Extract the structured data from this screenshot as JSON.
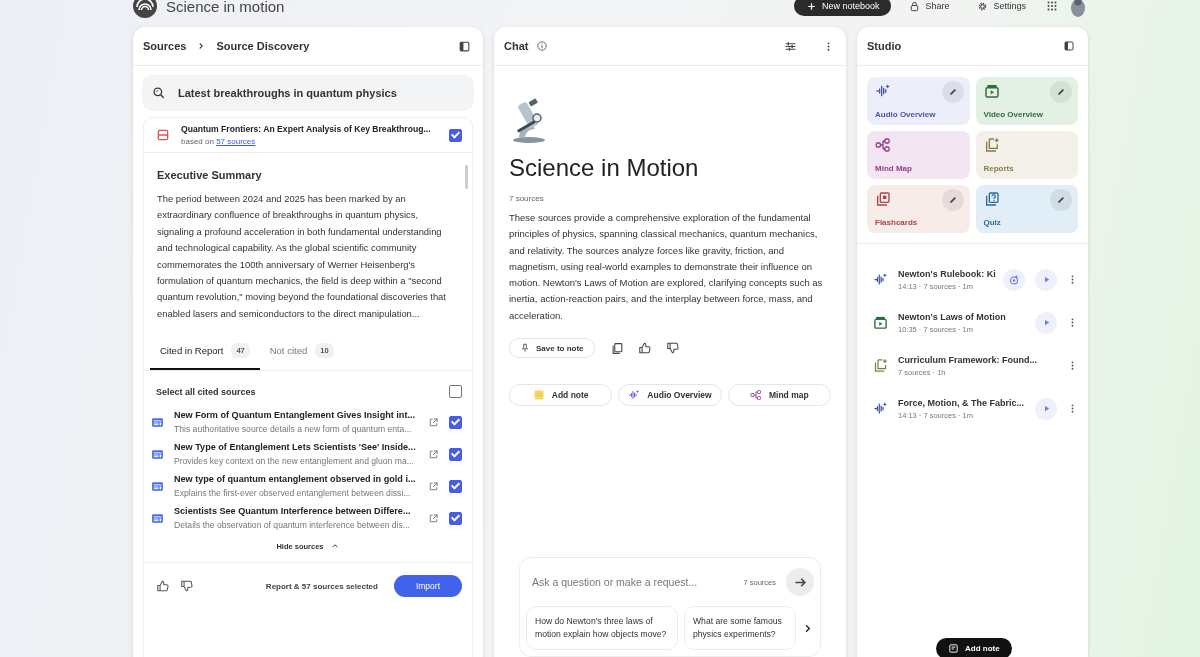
{
  "app": {
    "title": "Science in motion",
    "actions": [
      {
        "label": "New notebook",
        "kind": "primary"
      },
      {
        "label": "Share",
        "kind": "share"
      },
      {
        "label": "Settings",
        "kind": "settings"
      }
    ]
  },
  "sources": {
    "breadcrumb": [
      "Sources",
      "Source Discovery"
    ],
    "query": "Latest breakthroughs in quantum physics",
    "report": {
      "title": "Quantum Frontiers: An Expert Analysis of Key Breakthroug...",
      "based_on": "based on",
      "link": "57 sources",
      "checked": true,
      "heading": "Executive Summary",
      "body": "The period between 2024 and 2025 has been marked by an extraordinary confluence of breakthroughs in quantum physics, signaling a profound acceleration in both fundamental understanding and technological capability. As the global scientific community commemorates the 100th anniversary of Werner Heisenberg's formulation of quantum mechanics, the field is deep within a \"second quantum revolution,\" moving beyond the foundational discoveries that enabled lasers and semiconductors to the direct manipulation..."
    },
    "tabs": [
      {
        "label": "Cited in Report",
        "count": "47",
        "selected": true
      },
      {
        "label": "Not cited",
        "count": "10",
        "selected": false
      }
    ],
    "select_all": {
      "label": "Select all cited sources",
      "checked": false
    },
    "items": [
      {
        "title": "New Form of Quantum Entanglement Gives Insight int...",
        "description": "This authoritative source details a new form of quantum enta...",
        "checked": true
      },
      {
        "title": "New Type of Entanglement Lets Scientists 'See' Inside...",
        "description": "Provides key context on the new entanglement and gluon ma...",
        "checked": true
      },
      {
        "title": "New type of quantum entanglement observed in gold i...",
        "description": "Explains the first-ever observed entanglement between dissi...",
        "checked": true
      },
      {
        "title": "Scientists See Quantum Interference between Differe...",
        "description": "Details the observation of quantum interference between dis...",
        "checked": true
      }
    ],
    "hide_label": "Hide sources",
    "footer": {
      "status": "Report & 57 sources selected",
      "button": "Import"
    }
  },
  "chat": {
    "title": "Chat",
    "notebook_title": "Science in Motion",
    "source_count": "7 sources",
    "summary": "These sources provide a comprehensive exploration of the fundamental principles of physics, spanning classical mechanics, quantum mechanics, and relativity. The sources analyze forces like gravity, friction, and magnetism, using real-world examples to demonstrate their influence on motion. Newton's Laws of Motion are explored, clarifying concepts such as inertia, action-reaction pairs, and the interplay between force, mass, and acceleration.",
    "save_label": "Save to note",
    "chips": [
      {
        "label": "Add note",
        "kind": "note"
      },
      {
        "label": "Audio Overview",
        "kind": "audio"
      },
      {
        "label": "Mind map",
        "kind": "mindmap"
      }
    ],
    "input": {
      "placeholder": "Ask a question or make a request...",
      "source_count": "7 sources"
    },
    "suggestions": [
      "How do Newton's three laws of motion explain how objects move?",
      "What are some famous physics experiments?"
    ]
  },
  "studio": {
    "title": "Studio",
    "tiles": [
      {
        "label": "Audio Overview",
        "kind": "audio",
        "editable": true,
        "color": "#eceefa"
      },
      {
        "label": "Video Overview",
        "kind": "video",
        "editable": true,
        "color": "#e3f1e4"
      },
      {
        "label": "Mind Map",
        "kind": "mindmap",
        "editable": false,
        "color": "#f3e6f2"
      },
      {
        "label": "Reports",
        "kind": "reports",
        "editable": false,
        "color": "#f2f0e8"
      },
      {
        "label": "Flashcards",
        "kind": "flashcards",
        "editable": true,
        "color": "#f8ece9"
      },
      {
        "label": "Quiz",
        "kind": "quiz",
        "editable": true,
        "color": "#e1eef7"
      }
    ],
    "outputs": [
      {
        "title": "Newton's Rulebook: Ki",
        "meta": "14:13 · 7 sources · 1m",
        "kind": "audio",
        "interactive": true,
        "playable": true
      },
      {
        "title": "Newton's Laws of Motion",
        "meta": "10:35 · 7 sources · 1m",
        "kind": "video",
        "interactive": false,
        "playable": true
      },
      {
        "title": "Curriculum Framework: Found...",
        "meta": "7 sources · 1h",
        "kind": "reports",
        "interactive": false,
        "playable": false
      },
      {
        "title": "Force, Motion, & The Fabric...",
        "meta": "14:13 · 7 sources · 1m",
        "kind": "audio",
        "interactive": false,
        "playable": true
      }
    ],
    "add_note": "Add note"
  }
}
